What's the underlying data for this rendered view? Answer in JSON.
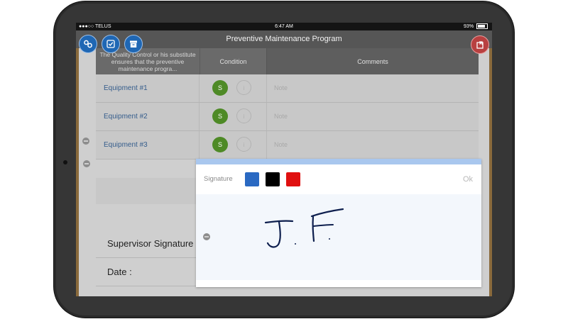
{
  "status_bar": {
    "carrier": "●●●○○ TELUS",
    "time": "6:47 AM",
    "battery": "93%",
    "battery_level": 0.93
  },
  "nav": {
    "title": "Preventive Maintenance Program"
  },
  "table": {
    "headers": [
      "The Quality Control or his substitute ensures that the preventive maintenance progra...",
      "Condition",
      "Comments"
    ],
    "rows": [
      {
        "name": "Equipment #1",
        "condition": "S",
        "info": "i",
        "note_placeholder": "Note"
      },
      {
        "name": "Equipment #2",
        "condition": "S",
        "info": "i",
        "note_placeholder": "Note"
      },
      {
        "name": "Equipment #3",
        "condition": "S",
        "info": "i",
        "note_placeholder": "Note"
      }
    ]
  },
  "form": {
    "supervisor_signature_label": "Supervisor Signature",
    "date_label": "Date :"
  },
  "signature_modal": {
    "label": "Signature",
    "ok_label": "Ok",
    "colors": [
      "#2a69c2",
      "#000000",
      "#e01010"
    ],
    "signature_text": "J.F."
  },
  "icons": {
    "top_left": [
      "link-icon",
      "checklist-icon",
      "archive-icon"
    ],
    "top_right": "export-icon"
  }
}
